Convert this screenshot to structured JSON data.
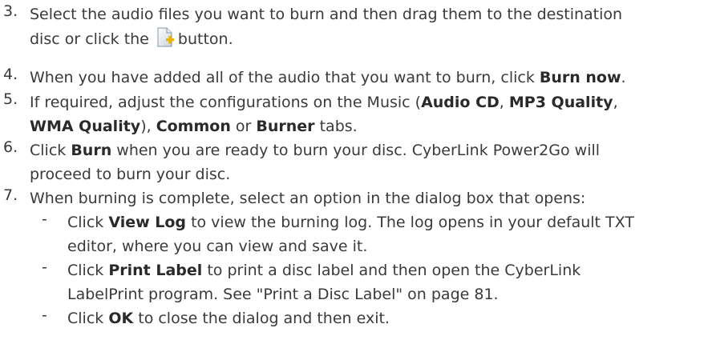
{
  "steps": [
    {
      "number": "3.",
      "line1": "Select the audio files you want to burn and then drag them to the destination",
      "line2_before": "disc or click the",
      "icon": "add-file-icon",
      "line2_after": "button."
    },
    {
      "number": "4.",
      "before": "When you have added all of the audio that you want to burn, click ",
      "bold": "Burn now",
      "after": "."
    },
    {
      "number": "5.",
      "part1": "If required, adjust the configurations on the Music (",
      "bold1": "Audio CD",
      "sep1": ", ",
      "bold2": "MP3 Quality",
      "sep2": ",",
      "bold3": "WMA Quality",
      "sep3": "), ",
      "bold4": "Common",
      "sep4": " or ",
      "bold5": "Burner",
      "part_end": " tabs."
    },
    {
      "number": "6.",
      "before": "Click ",
      "bold": "Burn",
      "after1": " when you are ready to burn your disc. CyberLink Power2Go will",
      "line2": "proceed to burn your disc."
    },
    {
      "number": "7.",
      "text": "When burning is complete, select an option in the dialog box that opens:"
    }
  ],
  "bullets": [
    {
      "dash": "-",
      "before": "Click ",
      "bold": "View Log",
      "after": " to view the burning log. The log opens in your default TXT",
      "line2": "editor, where you can view and save it."
    },
    {
      "dash": "-",
      "before": "Click ",
      "bold": "Print Label",
      "after": " to print a disc label and then open the CyberLink",
      "line2": "LabelPrint program. See \"Print a Disc Label\" on page 81."
    },
    {
      "dash": "-",
      "before": "Click ",
      "bold": "OK",
      "after": " to close the dialog and then exit."
    }
  ],
  "colors": {
    "text": "#3a3a3a",
    "icon_page": "#ffffff",
    "icon_plus": "#f0b400"
  }
}
